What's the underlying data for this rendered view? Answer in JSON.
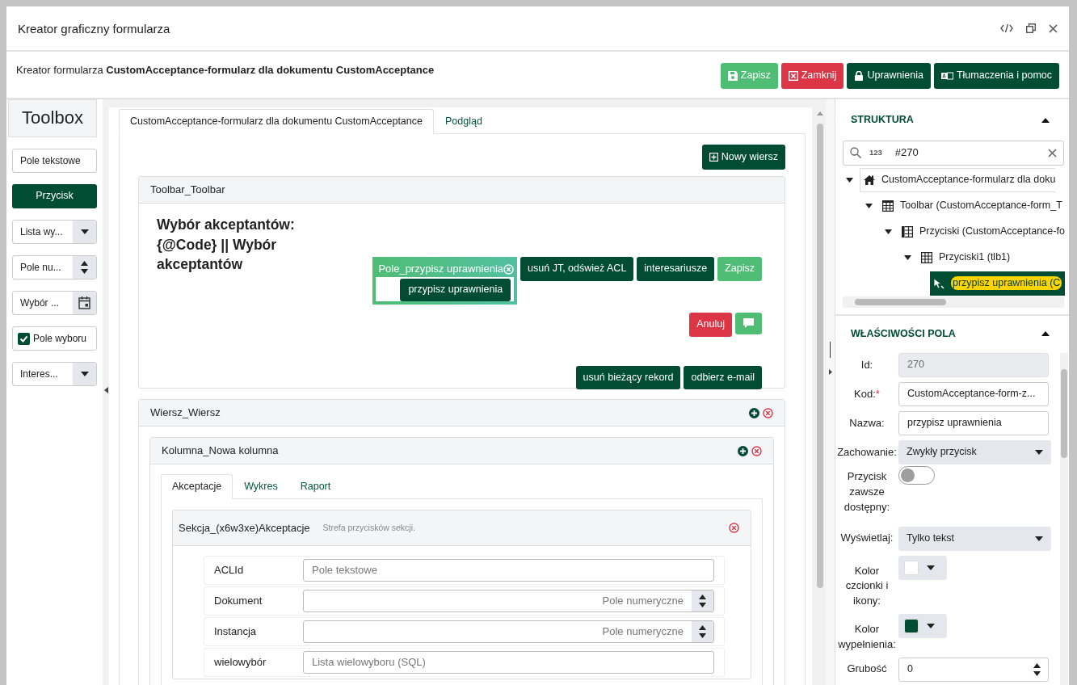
{
  "window": {
    "title": "Kreator graficzny formularza"
  },
  "header": {
    "text": "Kreator formularza **CustomAcceptance-formularz dla dokumentu CustomAcceptance**",
    "buttons": [
      {
        "label": "Zapisz",
        "kind": "save"
      },
      {
        "label": "Zamknij",
        "kind": "close"
      },
      {
        "label": "Uprawnienia",
        "kind": "lock"
      },
      {
        "label": "Tłumaczenia i pomoc",
        "kind": "translate"
      }
    ]
  },
  "toolbox": {
    "title": "Toolbox",
    "items": [
      {
        "kind": "text",
        "label": "Pole tekstowe"
      },
      {
        "kind": "button",
        "label": "Przycisk"
      },
      {
        "kind": "select",
        "label": "Lista wy..."
      },
      {
        "kind": "number",
        "label": "Pole nu..."
      },
      {
        "kind": "date",
        "label": "Wybór ..."
      },
      {
        "kind": "checkbox",
        "label": "Pole wyboru",
        "checked": true
      },
      {
        "kind": "select",
        "label": "Interes..."
      }
    ]
  },
  "tabs": [
    {
      "label": "CustomAcceptance-formularz dla dokumentu CustomAcceptance",
      "selected": true
    },
    {
      "label": "Podgląd",
      "selected": false
    }
  ],
  "new_row_button": "Nowy wiersz",
  "toolbar_panel": {
    "title": "Toolbar_Toolbar",
    "heading": "Wybór akceptantów: {@Code} || Wybór akceptantów",
    "selected_field": {
      "title": "Pole_przypisz uprawnienia",
      "button": "przypisz uprawnienia"
    },
    "button_rows": [
      [
        {
          "label": "usuń JT, odśwież ACL",
          "kind": "dark"
        },
        {
          "label": "interesariusze",
          "kind": "dark"
        },
        {
          "label": "Zapisz",
          "kind": "success"
        }
      ],
      [
        {
          "label": "Anuluj",
          "kind": "danger"
        },
        {
          "kind": "chat"
        }
      ],
      [
        {
          "label": "usuń bieżący rekord",
          "kind": "dark"
        },
        {
          "label": "odbierz e-mail",
          "kind": "dark"
        }
      ]
    ]
  },
  "row_panel": {
    "title": "Wiersz_Wiersz",
    "column": {
      "title": "Kolumna_Nowa kolumna",
      "tabs": [
        {
          "label": "Akceptacje",
          "selected": true
        },
        {
          "label": "Wykres",
          "selected": false
        },
        {
          "label": "Raport",
          "selected": false
        }
      ],
      "section": {
        "title": "Sekcja_(x6w3xe)Akceptacje",
        "hint": "Strefa przycisków sekcji.",
        "fields": [
          {
            "label": "ACLId",
            "kind": "text",
            "placeholder": "Pole tekstowe"
          },
          {
            "label": "Dokument",
            "kind": "number",
            "placeholder": "Pole numeryczne"
          },
          {
            "label": "Instancja",
            "kind": "number",
            "placeholder": "Pole numeryczne"
          },
          {
            "label": "wielowybór",
            "kind": "text",
            "placeholder": "Lista wielowyboru (SQL)"
          }
        ]
      }
    }
  },
  "structure": {
    "title": "STRUKTURA",
    "search": {
      "mode": "123",
      "value": "#270"
    },
    "tree": [
      {
        "kind": "root",
        "label": "CustomAcceptance-formularz dla doku",
        "selected": false,
        "children": [
          {
            "kind": "toolbar",
            "label": "Toolbar (CustomAcceptance-form_T",
            "selected": false,
            "children": [
              {
                "kind": "buttons",
                "label": "Przyciski (CustomAcceptance-fo",
                "selected": false,
                "children": [
                  {
                    "kind": "grid",
                    "label": "Przyciski1 (tlb1)",
                    "selected": false,
                    "children": [
                      {
                        "kind": "button",
                        "label": "przypisz uprawnienia (C",
                        "selected": true
                      }
                    ]
                  }
                ]
              }
            ]
          }
        ]
      }
    ]
  },
  "properties": {
    "title": "WŁAŚCIWOŚCI POLA",
    "fields": [
      {
        "label": "Id:",
        "kind": "readonly",
        "value": "270"
      },
      {
        "label": "Kod:",
        "required_mark": "*",
        "kind": "text",
        "value": "CustomAcceptance-form-z..."
      },
      {
        "label": "Nazwa:",
        "kind": "text",
        "value": "przypisz uprawnienia"
      },
      {
        "label": "Zachowanie:",
        "kind": "select",
        "value": "Zwykły przycisk"
      },
      {
        "label": "Przycisk zawsze dostępny:",
        "kind": "switch",
        "on": false
      },
      {
        "label": "Wyświetlaj:",
        "kind": "select",
        "value": "Tylko tekst"
      },
      {
        "label": "Kolor czcionki i ikony:",
        "kind": "color",
        "color": "#ffffff"
      },
      {
        "label": "Kolor wypełnienia:",
        "kind": "color",
        "color": "#004d33"
      },
      {
        "label": "Grubość",
        "kind": "number",
        "value": "0"
      }
    ]
  }
}
